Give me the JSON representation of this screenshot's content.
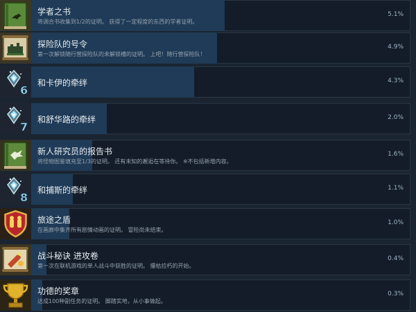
{
  "achievements": [
    {
      "title": "学者之书",
      "desc": "将调合书收集到1/2的证明。 获得了一定程度的东西的学者证明。",
      "percent": "5.1%",
      "value": 0.051,
      "icon": "green-book-bird-icon"
    },
    {
      "title": "探险队的号令",
      "desc": "第一次解锁随行营探险队的未解锁槽的证明。 上吧！随行营探险队！",
      "percent": "4.9%",
      "value": 0.049,
      "icon": "scroll-fortress-icon"
    },
    {
      "title": "和卡伊的牵绊",
      "desc": "",
      "percent": "4.3%",
      "value": 0.043,
      "icon": "bond-crystal-6-icon",
      "badge": "6"
    },
    {
      "title": "和舒华路的牵绊",
      "desc": "",
      "percent": "2.0%",
      "value": 0.02,
      "icon": "bond-crystal-7-icon",
      "badge": "7"
    },
    {
      "title": "新人研究员的报告书",
      "desc": "将怪物图鉴填充至1/3的证明。 还有未知的邂逅在等待你。 ※不包括新增内容。",
      "percent": "1.6%",
      "value": 0.016,
      "icon": "green-book-monster-icon"
    },
    {
      "title": "和捕斯的牵绊",
      "desc": "",
      "percent": "1.1%",
      "value": 0.011,
      "icon": "bond-crystal-8-icon",
      "badge": "8"
    },
    {
      "title": "旅途之盾",
      "desc": "在画廊中集齐所有剧情动画的证明。 冒险尚未结束。",
      "percent": "1.0%",
      "value": 0.01,
      "icon": "red-shield-icon"
    },
    {
      "title": "战斗秘诀 进攻卷",
      "desc": "第一次在联机游戏的单人战斗中获胜的证明。 攥枯拉朽的开始。",
      "percent": "0.4%",
      "value": 0.004,
      "icon": "scroll-attack-icon"
    },
    {
      "title": "功德的奖章",
      "desc": "达成100种副任务的证明。 脚踏实地，从小事做起。",
      "percent": "0.3%",
      "value": 0.003,
      "icon": "gold-trophy-icon"
    }
  ],
  "colors": {
    "background": "#1b2431",
    "row": "#131c28",
    "fill": "#1f3b57",
    "percent": "#9fb5c8"
  }
}
